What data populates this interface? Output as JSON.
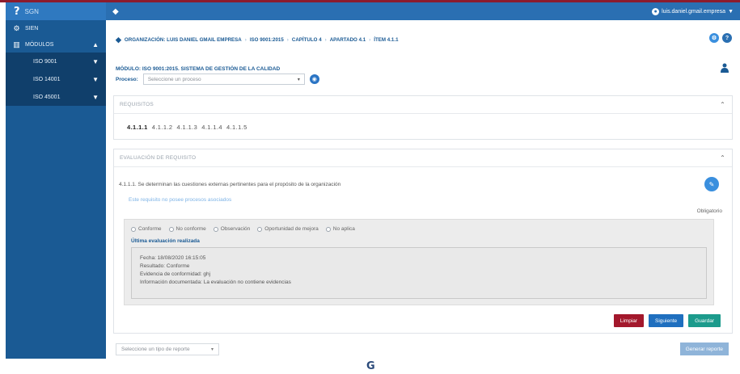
{
  "app": {
    "name": "SGN",
    "user": "luis.daniel.gmail.empresa"
  },
  "sidebar": {
    "items": [
      {
        "label": "SIEN"
      },
      {
        "label": "MÓDULOS"
      }
    ],
    "subitems": [
      {
        "label": "ISO 9001"
      },
      {
        "label": "ISO 14001"
      },
      {
        "label": "ISO 45001"
      }
    ]
  },
  "breadcrumb": {
    "items": [
      "ORGANIZACIÓN: LUIS DANIEL GMAIL EMPRESA",
      "ISO 9001:2015",
      "CAPÍTULO 4",
      "APARTADO 4.1",
      "ÍTEM 4.1.1"
    ],
    "sep": "›"
  },
  "modulo_title": "MÓDULO: ISO 9001:2015. SISTEMA DE GESTIÓN DE LA CALIDAD",
  "proceso": {
    "label": "Proceso:",
    "placeholder": "Seleccione un proceso"
  },
  "requisitos": {
    "title": "REQUISITOS",
    "items": [
      "4.1.1.1",
      "4.1.1.2",
      "4.1.1.3",
      "4.1.1.4",
      "4.1.1.5"
    ]
  },
  "evaluacion": {
    "title": "EVALUACIÓN DE REQUISITO",
    "text": "4.1.1.1. Se determinan las cuestiones externas pertinentes para el propósito de la organización",
    "no_process": "Este requisito no posee procesos asociados",
    "obligatorio": "Obligatorio",
    "options": [
      "Conforme",
      "No conforme",
      "Observación",
      "Oportunidad de mejora",
      "No aplica"
    ],
    "ultima_label": "Última evaluación realizada",
    "detail": [
      "Fecha: 18/08/2020 16:15:05",
      "Resultado: Conforme",
      "Evidencia de conformidad: ghj",
      "Información documentada: La evaluación no contiene evidencias"
    ]
  },
  "buttons": {
    "limpiar": "Limpiar",
    "siguiente": "Siguiente",
    "guardar": "Guardar"
  },
  "reporte": {
    "placeholder": "Seleccione un tipo de reporte",
    "generate": "Generar reporte"
  },
  "colors": {
    "sidebar": "#1a5a94",
    "topbar": "#2a6fb2",
    "accent": "#8c1c2e",
    "limpiar": "#a3182c",
    "siguiente": "#1f6fbf",
    "guardar": "#1c9b8c"
  }
}
